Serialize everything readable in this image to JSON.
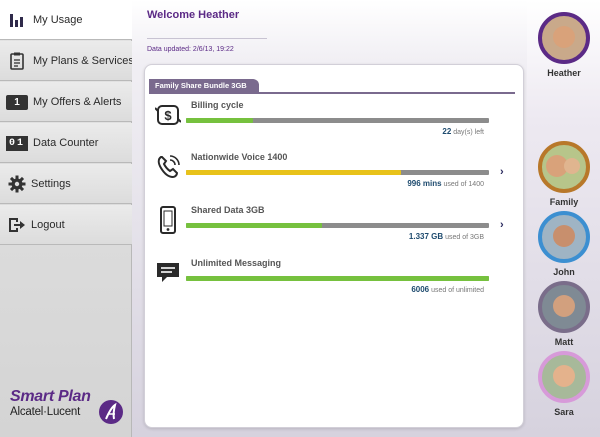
{
  "sidebar": {
    "items": [
      {
        "label": "My Usage",
        "icon": "bar-chart-icon",
        "active": true
      },
      {
        "label": "My Plans & Services",
        "icon": "clipboard-icon",
        "active": false
      },
      {
        "label": "My Offers & Alerts",
        "icon": "number-badge-icon",
        "active": false
      },
      {
        "label": "Data Counter",
        "icon": "counter-icon",
        "active": false
      },
      {
        "label": "Settings",
        "icon": "gear-icon",
        "active": false
      },
      {
        "label": "Logout",
        "icon": "logout-icon",
        "active": false
      }
    ],
    "offers_badge": "1",
    "counter_digits": "01",
    "brand": {
      "product": "Smart Plan",
      "company": "Alcatel·Lucent"
    }
  },
  "header": {
    "welcome": "Welcome Heather",
    "updated": "Data updated: 2/6/13, 19:22"
  },
  "bundle": {
    "title": "Family Share Bundle 3GB",
    "rows": [
      {
        "title": "Billing cycle",
        "icon": "dollar-cycle-icon",
        "number": "22",
        "suffix": " day(s) left",
        "progress": 0.22,
        "color": "#76c13e",
        "has_arrow": false
      },
      {
        "title": "Nationwide Voice 1400",
        "icon": "phone-icon",
        "number": "996 mins",
        "suffix": " used of 1400",
        "progress": 0.71,
        "color": "#e8c21a",
        "has_arrow": true
      },
      {
        "title": "Shared Data 3GB",
        "icon": "smartphone-icon",
        "number": "1.337 GB",
        "suffix": " used of 3GB",
        "progress": 0.45,
        "color": "#76c13e",
        "has_arrow": true
      },
      {
        "title": "Unlimited Messaging",
        "icon": "chat-icon",
        "number": "6006",
        "suffix": " used of unlimited",
        "progress": 1.0,
        "color": "#76c13e",
        "has_arrow": false
      }
    ]
  },
  "contacts": [
    {
      "name": "Heather",
      "ring": "#5b2a86"
    },
    {
      "name": "Family",
      "ring": "#b8782a"
    },
    {
      "name": "John",
      "ring": "#3c8fd1"
    },
    {
      "name": "Matt",
      "ring": "#7a6d8a"
    },
    {
      "name": "Sara",
      "ring": "#d79ad9"
    }
  ]
}
